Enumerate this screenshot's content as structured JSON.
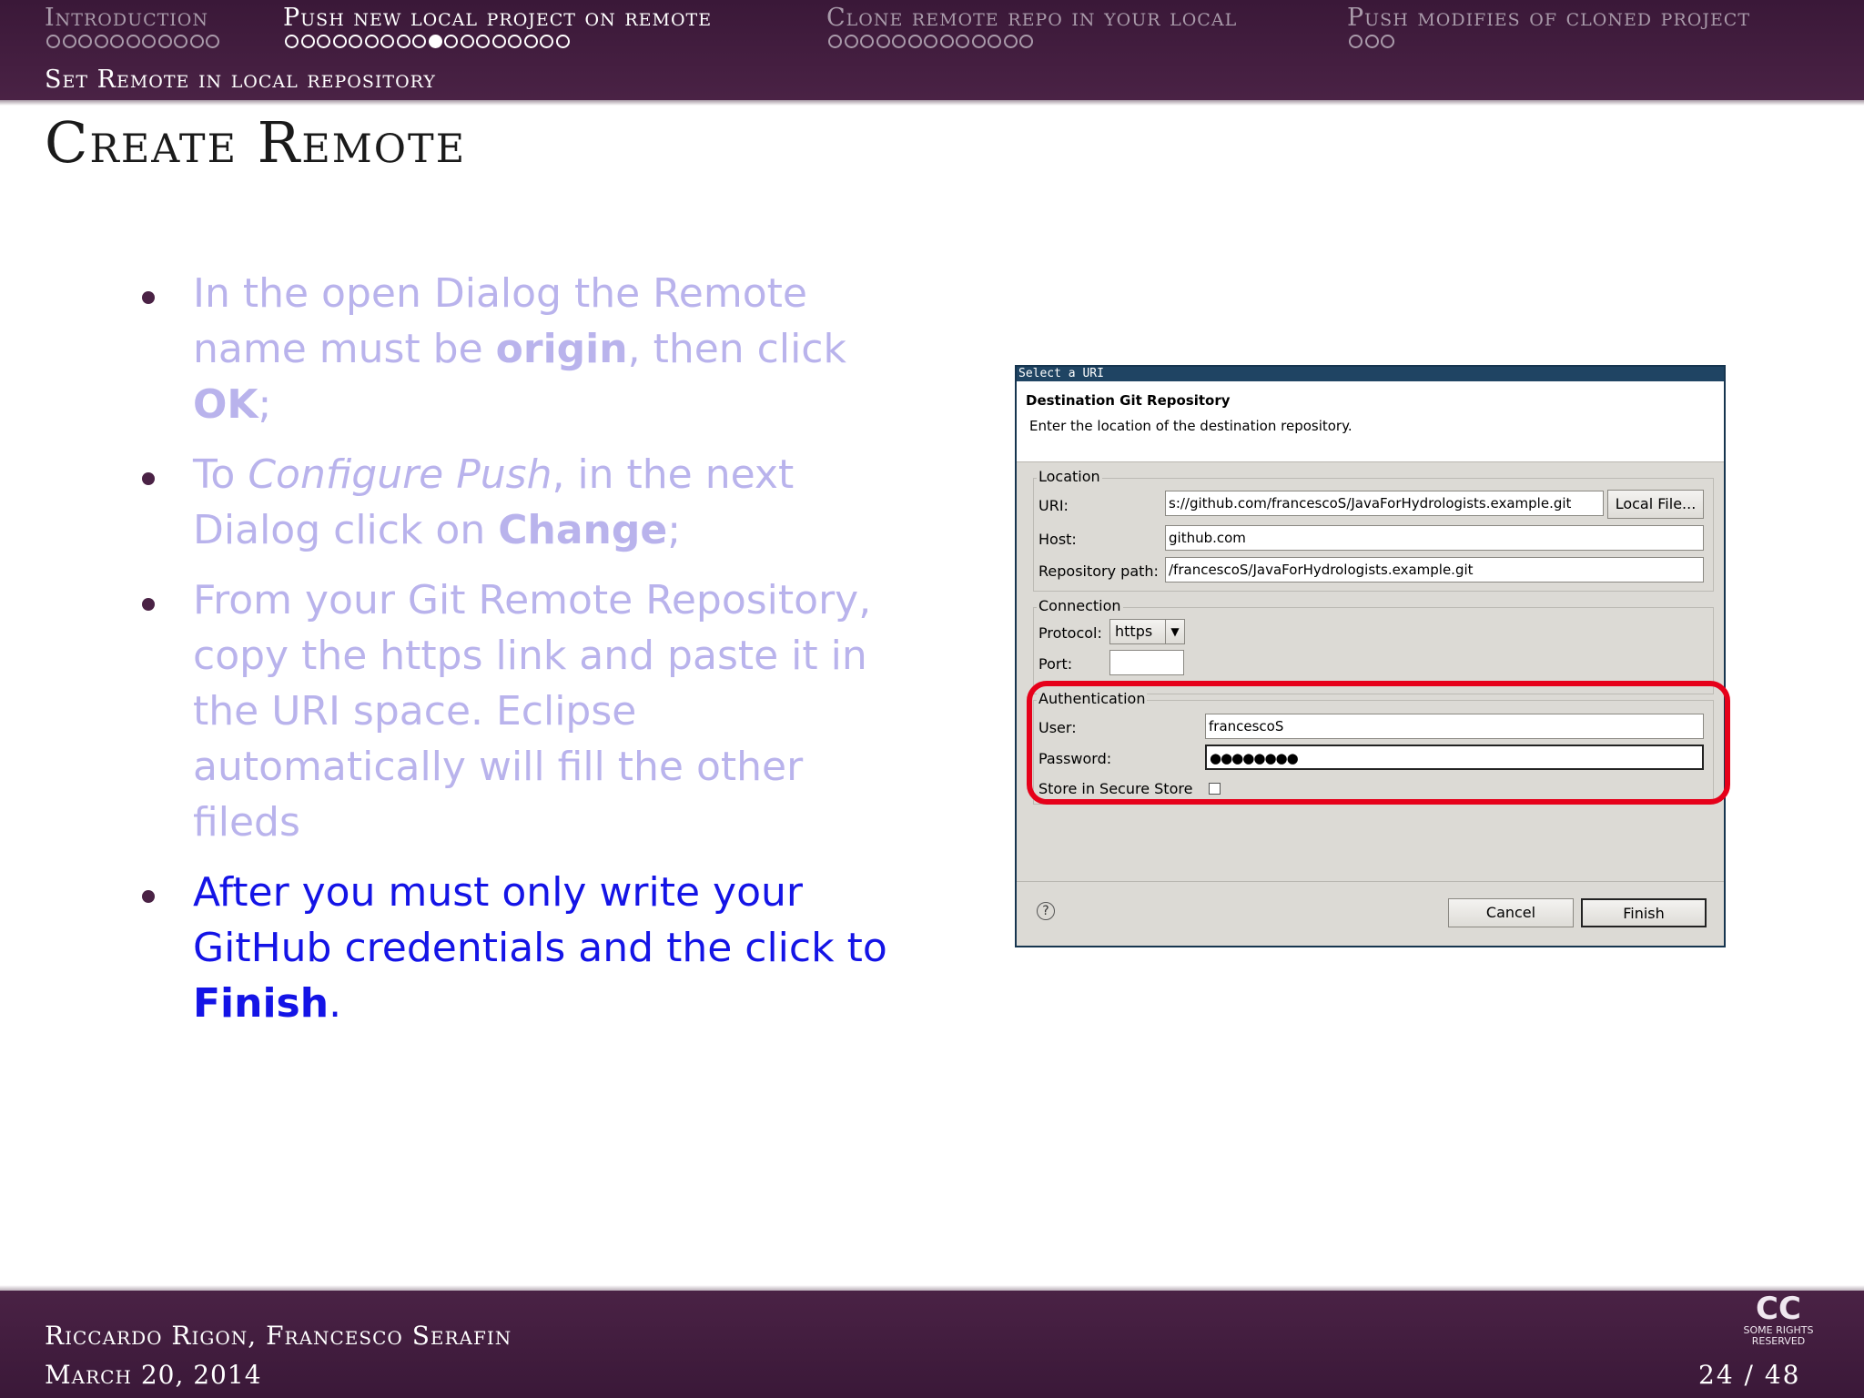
{
  "nav": {
    "sections": [
      {
        "label": "Introduction",
        "dots": 11,
        "filled_index": -1
      },
      {
        "label": "Push new local project on remote",
        "dots": 18,
        "filled_index": 9
      },
      {
        "label": "Clone remote repo in your local",
        "dots": 13,
        "filled_index": -1
      },
      {
        "label": "Push modifies of cloned project",
        "dots": 3,
        "filled_index": -1
      }
    ],
    "active_section": 1,
    "subsection": "Set Remote in local repository"
  },
  "frame": {
    "title": "Create Remote"
  },
  "bullets": [
    {
      "state": "dim",
      "parts": [
        {
          "text": "In the open Dialog the Remote name must be "
        },
        {
          "text": "origin",
          "style": "bold"
        },
        {
          "text": ", then click "
        },
        {
          "text": "OK",
          "style": "bold"
        },
        {
          "text": ";"
        }
      ]
    },
    {
      "state": "dim",
      "parts": [
        {
          "text": "To "
        },
        {
          "text": "Configure Push",
          "style": "italic"
        },
        {
          "text": ", in the next Dialog click on "
        },
        {
          "text": "Change",
          "style": "bold"
        },
        {
          "text": ";"
        }
      ]
    },
    {
      "state": "dim",
      "parts": [
        {
          "text": "From your Git Remote Repository, copy the https link and paste it in the URI space.  Eclipse automatically will fill the other fileds"
        }
      ]
    },
    {
      "state": "current",
      "parts": [
        {
          "text": "After you must only write your GitHub credentials and the click to "
        },
        {
          "text": "Finish",
          "style": "bold"
        },
        {
          "text": "."
        }
      ]
    }
  ],
  "dialog": {
    "window_title": "Select a URI",
    "header_title": "Destination Git Repository",
    "header_desc": "Enter the location of the destination repository.",
    "location_group": "Location",
    "uri_label": "URI:",
    "uri_value": "s://github.com/francescoS/JavaForHydrologists.example.git",
    "local_file_button": "Local File...",
    "host_label": "Host:",
    "host_value": "github.com",
    "repo_path_label": "Repository path:",
    "repo_path_value": "/francescoS/JavaForHydrologists.example.git",
    "connection_group": "Connection",
    "protocol_label": "Protocol:",
    "protocol_value": "https",
    "port_label": "Port:",
    "port_value": "",
    "auth_group": "Authentication",
    "user_label": "User:",
    "user_value": "francescoS",
    "password_label": "Password:",
    "password_value": "●●●●●●●●",
    "store_label": "Store in Secure Store",
    "store_checked": false,
    "help_glyph": "?",
    "cancel_button": "Cancel",
    "finish_button": "Finish",
    "highlight_color": "#e6001a"
  },
  "footer": {
    "authors": "Riccardo Rigon, Francesco Serafin",
    "date": "March 20, 2014",
    "page": "24 / 48",
    "license_big": "CC",
    "license_small": "SOME RIGHTS RESERVED"
  },
  "colors": {
    "theme": "#4a2245",
    "dim_text": "#b9b3ec",
    "current_text": "#1414e6"
  }
}
